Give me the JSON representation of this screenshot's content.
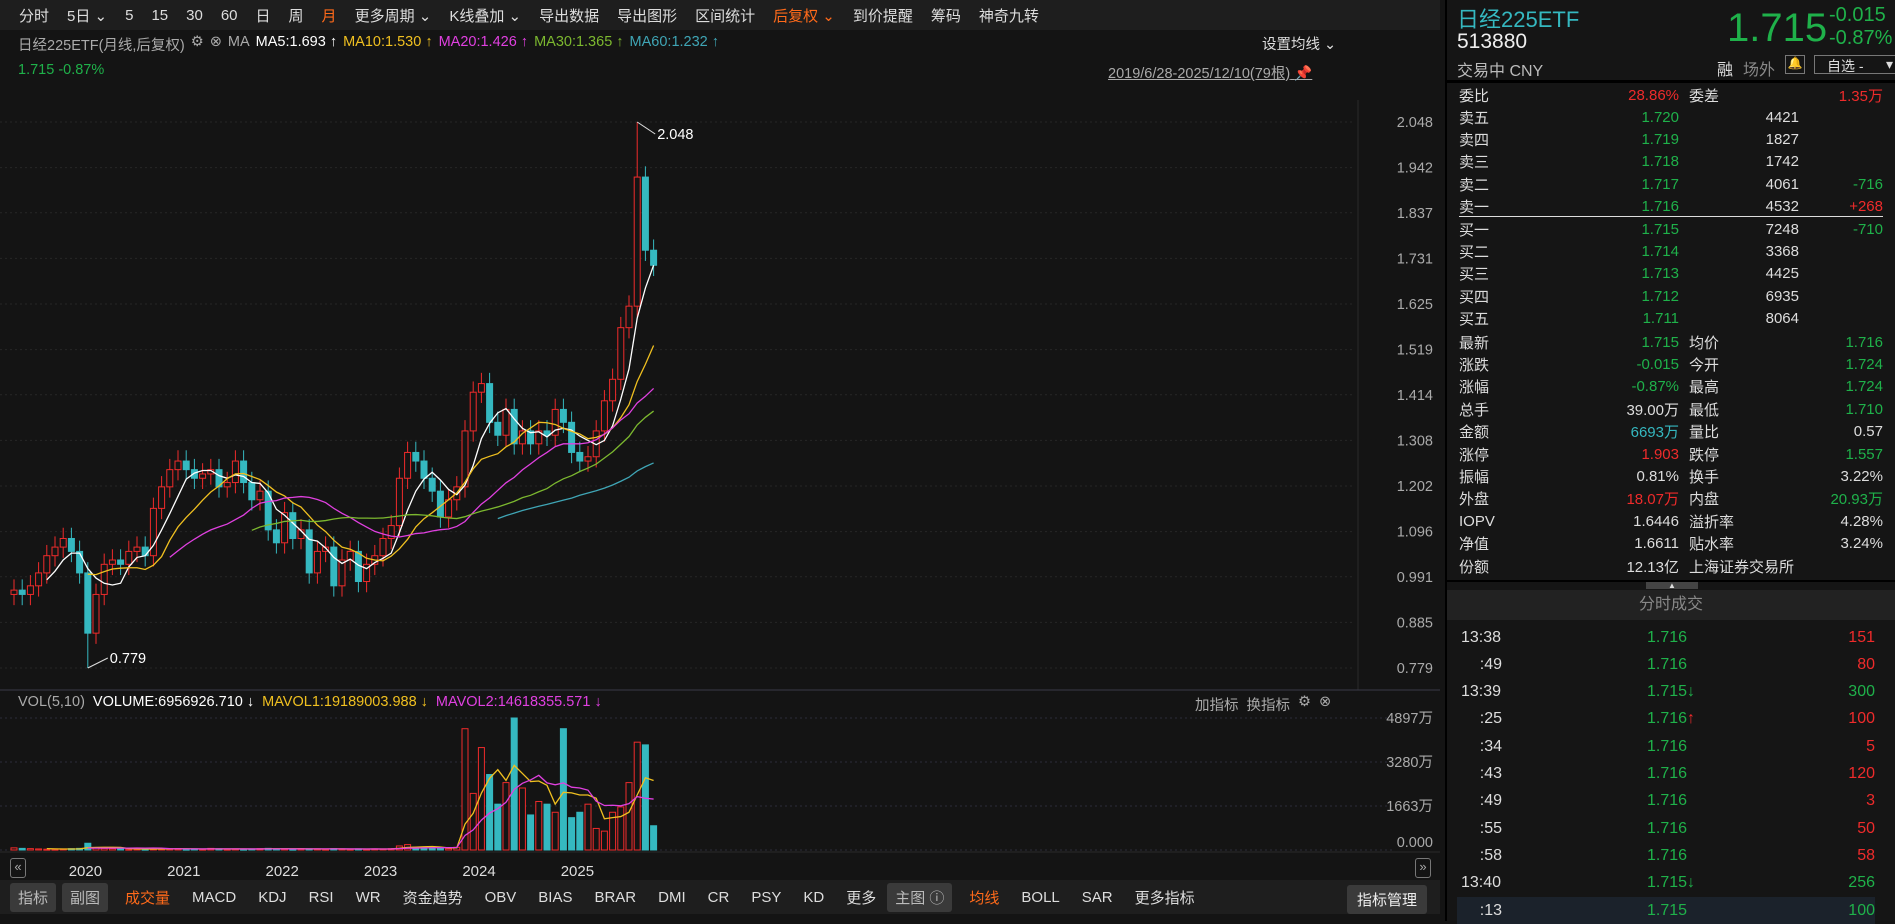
{
  "toolbar": {
    "items": [
      "分时",
      "5日 ⌄",
      "5",
      "15",
      "30",
      "60",
      "日",
      "周",
      "月",
      "更多周期 ⌄",
      "K线叠加 ⌄",
      "导出数据",
      "导出图形",
      "区间统计",
      "后复权 ⌄",
      "到价提醒",
      "筹码",
      "神奇九转"
    ],
    "active": [
      8,
      14
    ]
  },
  "header": {
    "title": "日经225ETF(月线,后复权)",
    "ma_label": "MA",
    "ma": [
      {
        "t": "MA5:1.693 ↑",
        "color": "#ffffff"
      },
      {
        "t": "MA10:1.530 ↑",
        "color": "#f0c020"
      },
      {
        "t": "MA20:1.426 ↑",
        "color": "#e040e0"
      },
      {
        "t": "MA30:1.365 ↑",
        "color": "#7cb82f"
      },
      {
        "t": "MA60:1.232 ↑",
        "color": "#3fa5b5"
      }
    ],
    "last": "1.715 -0.87%",
    "set_ma": "设置均线 ⌄",
    "range": "2019/6/28-2025/12/10(79根)"
  },
  "volume_header": {
    "name": "VOL(5,10)",
    "volume": "VOLUME:6956926.710 ↓",
    "mavol1": "MAVOL1:19189003.988 ↓",
    "mavol2": "MAVOL2:14618355.571 ↓",
    "add": "加指标",
    "switch": "换指标"
  },
  "bottom": {
    "items": [
      "指标",
      "副图",
      "成交量",
      "MACD",
      "KDJ",
      "RSI",
      "WR",
      "资金趋势",
      "OBV",
      "BIAS",
      "BRAR",
      "DMI",
      "CR",
      "PSY",
      "KD",
      "更多",
      "主图 ⓘ",
      "均线",
      "BOLL",
      "SAR",
      "更多指标"
    ],
    "manage": "指标管理"
  },
  "chart_data": {
    "type": "candlestick",
    "period": "monthly",
    "start": "2019/6",
    "end": "2025/12",
    "price_ticks": [
      "2.048",
      "1.942",
      "1.837",
      "1.731",
      "1.625",
      "1.519",
      "1.414",
      "1.308",
      "1.202",
      "1.096",
      "0.991",
      "0.885",
      "0.779"
    ],
    "ylim": [
      0.779,
      2.048
    ],
    "high_label": "2.048",
    "low_label": "0.779",
    "years": [
      "2020",
      "2021",
      "2022",
      "2023",
      "2024",
      "2025"
    ],
    "closes": [
      0.96,
      0.95,
      0.97,
      1.0,
      1.04,
      1.06,
      1.08,
      1.05,
      1.0,
      0.86,
      0.95,
      1.02,
      1.03,
      1.02,
      1.05,
      1.06,
      1.04,
      1.15,
      1.2,
      1.24,
      1.26,
      1.24,
      1.22,
      1.23,
      1.24,
      1.2,
      1.21,
      1.26,
      1.21,
      1.17,
      1.19,
      1.1,
      1.07,
      1.14,
      1.08,
      1.1,
      1.0,
      1.05,
      1.06,
      0.97,
      1.03,
      1.05,
      0.98,
      1.02,
      1.04,
      1.08,
      1.11,
      1.22,
      1.28,
      1.26,
      1.22,
      1.19,
      1.13,
      1.17,
      1.2,
      1.33,
      1.42,
      1.44,
      1.35,
      1.32,
      1.38,
      1.3,
      1.33,
      1.3,
      1.33,
      1.32,
      1.38,
      1.35,
      1.28,
      1.26,
      1.27,
      1.33,
      1.4,
      1.45,
      1.57,
      1.62,
      1.92,
      1.75,
      1.715
    ],
    "vol_ticks": [
      "4897万",
      "3280万",
      "1663万",
      "0.000"
    ],
    "vol_max": 4897,
    "volumes": [
      80,
      60,
      50,
      40,
      30,
      30,
      40,
      50,
      60,
      250,
      90,
      60,
      50,
      40,
      30,
      40,
      30,
      60,
      50,
      40,
      50,
      30,
      40,
      30,
      60,
      40,
      30,
      40,
      30,
      40,
      50,
      60,
      40,
      40,
      30,
      50,
      40,
      40,
      30,
      50,
      40,
      30,
      40,
      30,
      40,
      40,
      50,
      150,
      200,
      100,
      100,
      90,
      60,
      50,
      100,
      4500,
      2100,
      3800,
      2800,
      1700,
      2500,
      4897,
      2300,
      1300,
      1800,
      1700,
      1400,
      4500,
      1200,
      1400,
      1700,
      800,
      700,
      1400,
      1600,
      2500,
      4000,
      3900,
      900
    ]
  },
  "quote": {
    "name": "日经225ETF",
    "code": "513880",
    "status": "交易中 CNY",
    "price": "1.715",
    "change": "-0.015",
    "pct": "-0.87%",
    "rong": "融",
    "offsite": "场外",
    "watch": "自选 -"
  },
  "orderbook": {
    "wb_label": "委比",
    "wb": "28.86%",
    "wc_label": "委差",
    "wc": "1.35万",
    "asks": [
      {
        "l": "卖五",
        "p": "1.720",
        "v": "4421",
        "d": ""
      },
      {
        "l": "卖四",
        "p": "1.719",
        "v": "1827",
        "d": ""
      },
      {
        "l": "卖三",
        "p": "1.718",
        "v": "1742",
        "d": ""
      },
      {
        "l": "卖二",
        "p": "1.717",
        "v": "4061",
        "d": "-716"
      },
      {
        "l": "卖一",
        "p": "1.716",
        "v": "4532",
        "d": "+268"
      }
    ],
    "bids": [
      {
        "l": "买一",
        "p": "1.715",
        "v": "7248",
        "d": "-710"
      },
      {
        "l": "买二",
        "p": "1.714",
        "v": "3368",
        "d": ""
      },
      {
        "l": "买三",
        "p": "1.713",
        "v": "4425",
        "d": ""
      },
      {
        "l": "买四",
        "p": "1.712",
        "v": "6935",
        "d": ""
      },
      {
        "l": "买五",
        "p": "1.711",
        "v": "8064",
        "d": ""
      }
    ]
  },
  "stats": [
    [
      "最新",
      "1.715",
      "g",
      "均价",
      "1.716",
      "g"
    ],
    [
      "涨跌",
      "-0.015",
      "g",
      "今开",
      "1.724",
      "g"
    ],
    [
      "涨幅",
      "-0.87%",
      "g",
      "最高",
      "1.724",
      "g"
    ],
    [
      "总手",
      "39.00万",
      "w",
      "最低",
      "1.710",
      "g"
    ],
    [
      "金额",
      "6693万",
      "cy",
      "量比",
      "0.57",
      "w"
    ],
    [
      "涨停",
      "1.903",
      "r",
      "跌停",
      "1.557",
      "g"
    ],
    [
      "振幅",
      "0.81%",
      "w",
      "换手",
      "3.22%",
      "w"
    ],
    [
      "外盘",
      "18.07万",
      "r",
      "内盘",
      "20.93万",
      "g"
    ],
    [
      "IOPV",
      "1.6446",
      "w",
      "溢折率",
      "4.28%",
      "w"
    ],
    [
      "净值",
      "1.6611",
      "w",
      "贴水率",
      "3.24%",
      "w"
    ],
    [
      "份额",
      "12.13亿",
      "w",
      "上海证券交易所",
      "",
      " w"
    ]
  ],
  "trades_title": "分时成交",
  "trades": [
    [
      "13:38",
      "1.716",
      "",
      "151",
      "r"
    ],
    [
      ":49",
      "1.716",
      "",
      "80",
      "r"
    ],
    [
      "13:39",
      "1.715",
      "↓",
      "300",
      "g"
    ],
    [
      ":25",
      "1.716",
      "↑",
      "100",
      "r"
    ],
    [
      ":34",
      "1.716",
      "",
      "5",
      "r"
    ],
    [
      ":43",
      "1.716",
      "",
      "120",
      "r"
    ],
    [
      ":49",
      "1.716",
      "",
      "3",
      "r"
    ],
    [
      ":55",
      "1.716",
      "",
      "50",
      "r"
    ],
    [
      ":58",
      "1.716",
      "",
      "58",
      "r"
    ],
    [
      "13:40",
      "1.715",
      "↓",
      "256",
      "g"
    ],
    [
      ":13",
      "1.715",
      "",
      "100",
      "g"
    ]
  ]
}
